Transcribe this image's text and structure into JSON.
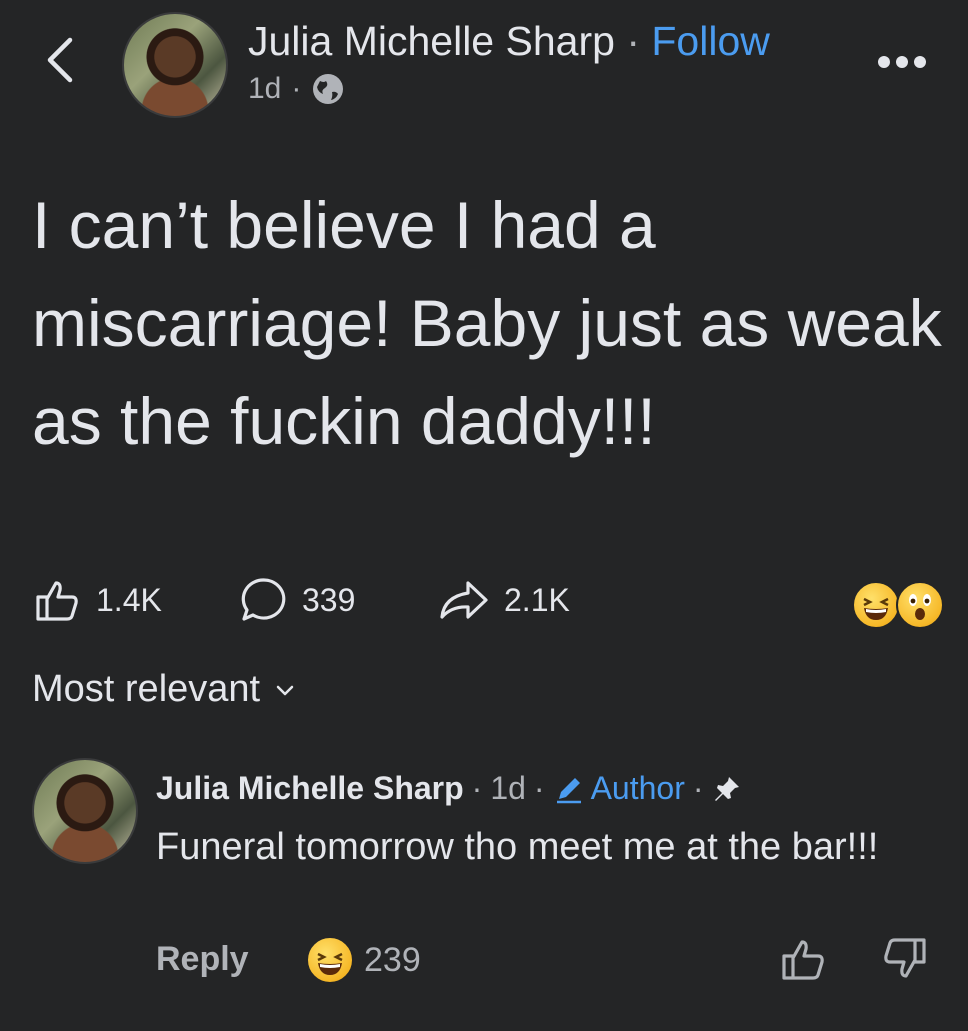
{
  "header": {
    "author_name": "Julia Michelle Sharp",
    "separator": "·",
    "follow_label": "Follow",
    "time": "1d",
    "meta_separator": "·",
    "audience_icon": "globe-icon"
  },
  "post": {
    "text": "I can’t believe I had a miscarriage! Baby just as weak as the fuckin daddy!!!"
  },
  "stats": {
    "likes": "1.4K",
    "comments": "339",
    "shares": "2.1K",
    "reactions": [
      "grinning-squinting-emoji",
      "astonished-emoji"
    ]
  },
  "sort": {
    "label": "Most relevant"
  },
  "comment": {
    "author_name": "Julia Michelle Sharp",
    "sep1": "·",
    "time": "1d",
    "sep2": "·",
    "author_badge": "Author",
    "sep3": "·",
    "text": "Funeral tomorrow tho meet me at the bar!!!",
    "reply_label": "Reply",
    "reaction_count": "239"
  },
  "colors": {
    "background": "#242526",
    "text": "#e4e6eb",
    "secondary": "#b0b3b8",
    "accent": "#4b9cf0"
  }
}
